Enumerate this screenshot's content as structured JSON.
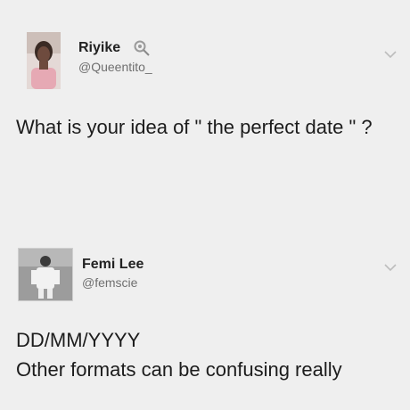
{
  "tweets": [
    {
      "name": "Riyike",
      "badge_icon": "lollipop-icon",
      "handle": "@Queentito_",
      "text": "What is your idea of \" the perfect date \" ?"
    },
    {
      "name": "Femi Lee",
      "handle": "@femscie",
      "text_lines": [
        "DD/MM/YYYY",
        "Other formats can be confusing really"
      ]
    }
  ],
  "colors": {
    "background": "#efefef",
    "text": "#1c1c1c",
    "handle": "#6f6f6f"
  }
}
